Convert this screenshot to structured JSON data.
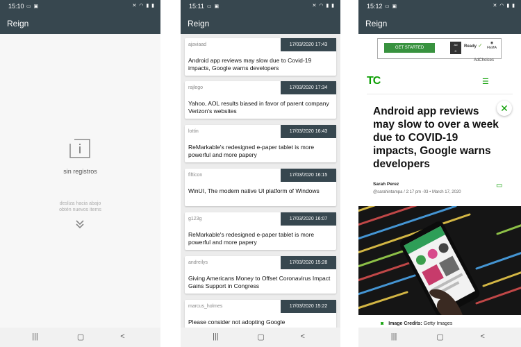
{
  "phone1": {
    "status_time": "15:10",
    "app_title": "Reign",
    "empty_title": "sin registros",
    "empty_hint_line1": "desliza hacia abajo",
    "empty_hint_line2": "obtén nuevos items"
  },
  "phone2": {
    "status_time": "15:11",
    "app_title": "Reign",
    "items": [
      {
        "author": "ajaviaad",
        "date": "17/03/2020 17:43",
        "title": "Android app reviews may slow due to Covid-19 impacts, Google warns developers"
      },
      {
        "author": "rajlego",
        "date": "17/03/2020 17:34",
        "title": "Yahoo, AOL results biased in favor of parent company Verizon's websites"
      },
      {
        "author": "lottin",
        "date": "17/03/2020 16:43",
        "title": "ReMarkable's redesigned e-paper tablet is more powerful and more papery"
      },
      {
        "author": "fifticon",
        "date": "17/03/2020 16:15",
        "title": "WinUI, The modern native UI platform of Windows"
      },
      {
        "author": "g123g",
        "date": "17/03/2020 16:07",
        "title": "ReMarkable's redesigned e-paper tablet is more powerful and more papery"
      },
      {
        "author": "andreilys",
        "date": "17/03/2020 15:28",
        "title": "Giving Americans Money to Offset Coronavirus Impact Gains Support in Congress"
      },
      {
        "author": "marcus_holmes",
        "date": "17/03/2020 15:22",
        "title": "Please consider not adopting Google"
      }
    ]
  },
  "phone3": {
    "status_time": "15:12",
    "app_title": "Reign",
    "ad_button": "GET STARTED",
    "ad_ready": "Ready",
    "ad_fema": "FEMA",
    "ad_choices": "AdChoices",
    "logo": "TC",
    "article_title": "Android app reviews may slow to over a week due to COVID-19 impacts, Google warns developers",
    "author": "Sarah Perez",
    "handle": "@sarahintampa",
    "time": "2:17 pm -03",
    "date": "March 17, 2020",
    "image_credits_label": "Image Credits:",
    "image_credits_value": "Getty Images"
  },
  "colors": {
    "toolbar": "#37474f",
    "tc_green": "#0a9e01",
    "ad_green": "#38923f"
  },
  "icons": {
    "empty": "info-box-icon",
    "swipe": "double-chevron-down-icon",
    "nav_recents": "recents-icon",
    "nav_home": "home-icon",
    "nav_back": "back-icon"
  }
}
